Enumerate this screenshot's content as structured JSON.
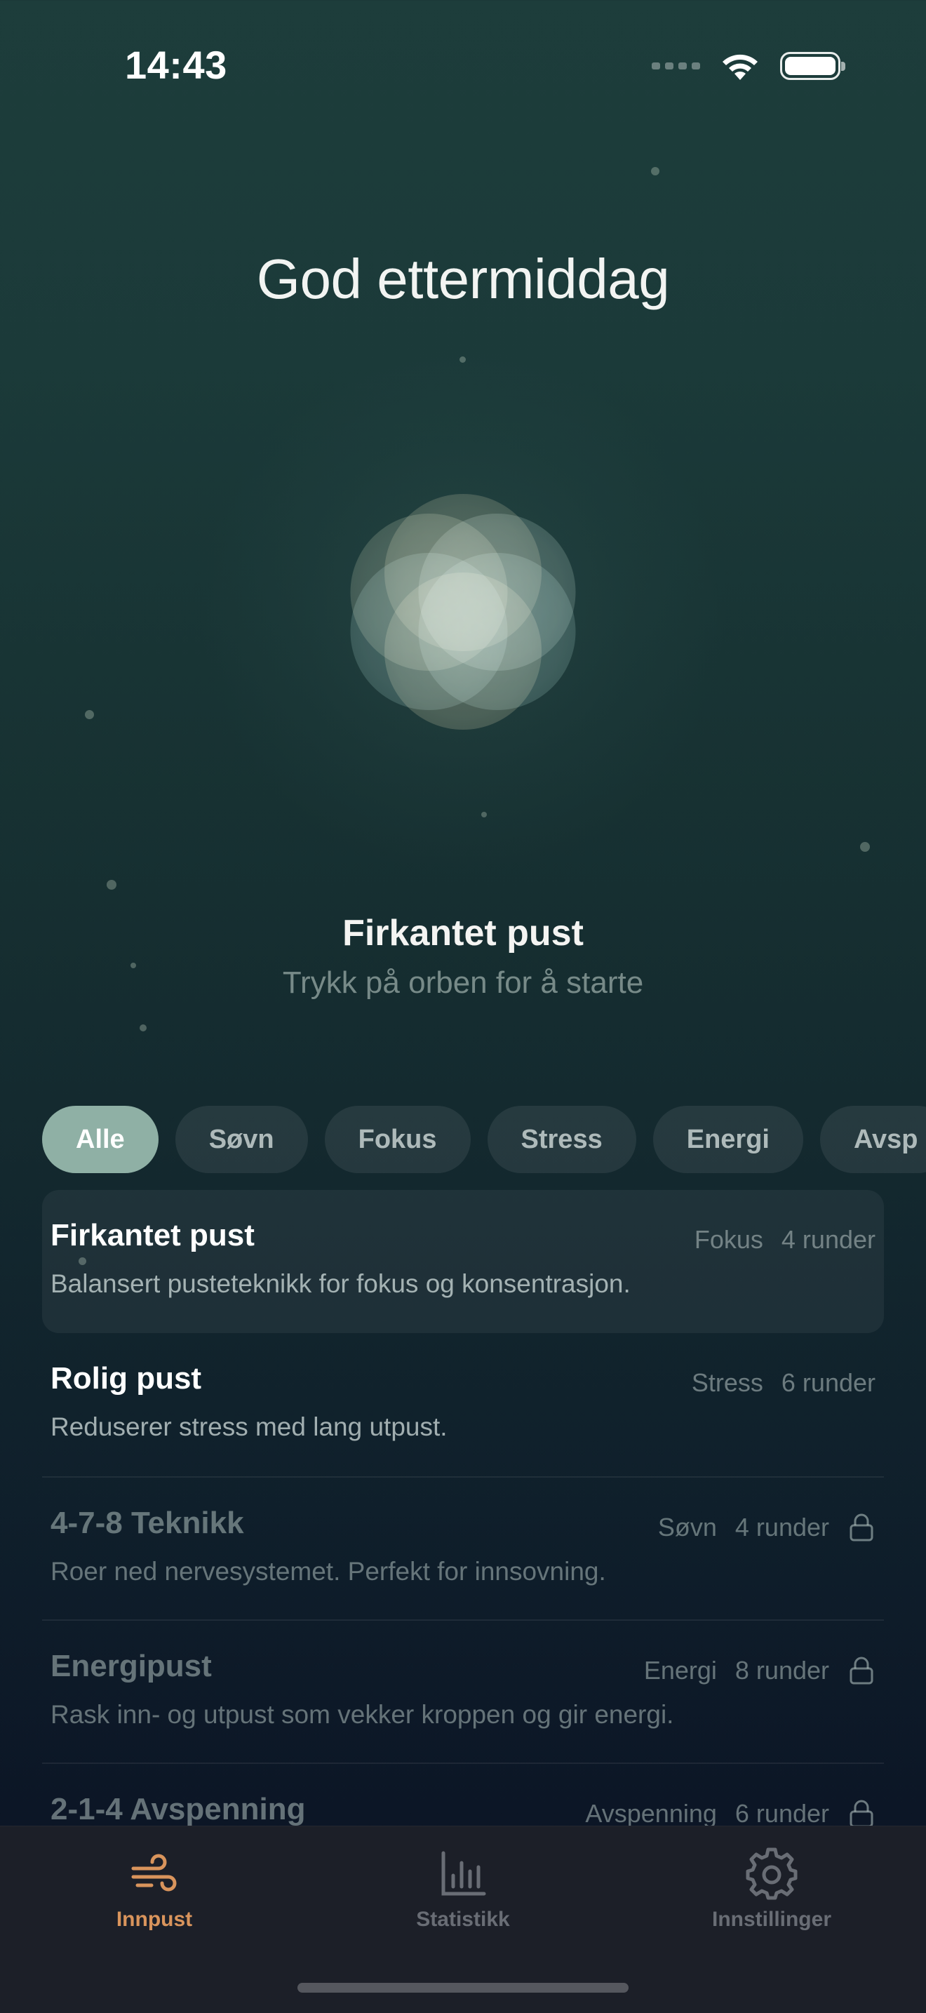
{
  "status_bar": {
    "time": "14:43"
  },
  "greeting": "God ettermiddag",
  "orb": {
    "petal_colors": [
      "#8f8a6c",
      "#7f8f86",
      "#6f8a84",
      "#9a9270",
      "#6d8782",
      "#8a8c72"
    ]
  },
  "current": {
    "title": "Firkantet pust",
    "subtitle": "Trykk på orben for å starte"
  },
  "filters": [
    {
      "label": "Alle"
    },
    {
      "label": "Søvn"
    },
    {
      "label": "Fokus"
    },
    {
      "label": "Stress"
    },
    {
      "label": "Energi"
    },
    {
      "label": "Avsp"
    }
  ],
  "techniques": [
    {
      "name": "Firkantet pust",
      "category": "Fokus",
      "rounds": "4 runder",
      "description": "Balansert pusteteknikk for fokus og konsentrasjon.",
      "locked": false
    },
    {
      "name": "Rolig pust",
      "category": "Stress",
      "rounds": "6 runder",
      "description": "Reduserer stress med lang utpust.",
      "locked": false
    },
    {
      "name": "4-7-8 Teknikk",
      "category": "Søvn",
      "rounds": "4 runder",
      "description": "Roer ned nervesystemet. Perfekt for innsovning.",
      "locked": true
    },
    {
      "name": "Energipust",
      "category": "Energi",
      "rounds": "8 runder",
      "description": "Rask inn- og utpust som vekker kroppen og gir energi.",
      "locked": true
    },
    {
      "name": "2-1-4 Avspenning",
      "category": "Avspenning",
      "rounds": "6 runder",
      "description": "",
      "locked": true
    }
  ],
  "tabbar": {
    "tabs": [
      {
        "label": "Innpust",
        "icon": "wind-icon"
      },
      {
        "label": "Statistikk",
        "icon": "bar-chart-icon"
      },
      {
        "label": "Innstillinger",
        "icon": "gear-icon"
      }
    ],
    "active_color": "#d9945c"
  }
}
